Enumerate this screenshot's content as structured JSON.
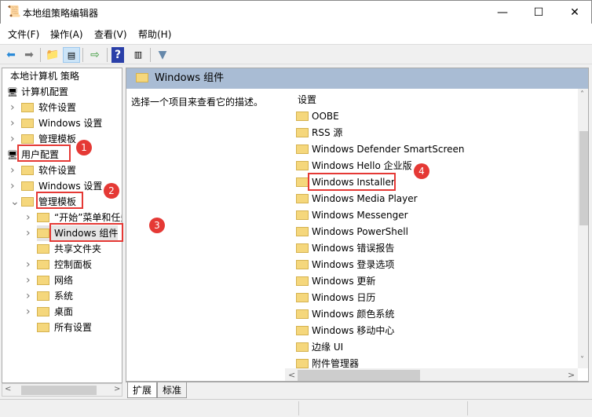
{
  "window": {
    "title": "本地组策略编辑器",
    "minimize": "—",
    "maximize": "☐",
    "close": "✕"
  },
  "menu": [
    "文件(F)",
    "操作(A)",
    "查看(V)",
    "帮助(H)"
  ],
  "tree": [
    {
      "label": "本地计算机 策略",
      "level": 0,
      "chev": ""
    },
    {
      "label": "计算机配置",
      "level": 0,
      "chev": ""
    },
    {
      "label": "软件设置",
      "level": 1,
      "chev": ">"
    },
    {
      "label": "Windows 设置",
      "level": 1,
      "chev": ">"
    },
    {
      "label": "管理模板",
      "level": 1,
      "chev": ">"
    },
    {
      "label": "用户配置",
      "level": 0,
      "chev": ""
    },
    {
      "label": "软件设置",
      "level": 1,
      "chev": ">"
    },
    {
      "label": "Windows 设置",
      "level": 1,
      "chev": ">"
    },
    {
      "label": "管理模板",
      "level": 1,
      "chev": "v"
    },
    {
      "label": "“开始”菜单和任务栏",
      "level": 2,
      "chev": ">"
    },
    {
      "label": "Windows 组件",
      "level": 2,
      "chev": ">"
    },
    {
      "label": "共享文件夹",
      "level": 2,
      "chev": ""
    },
    {
      "label": "控制面板",
      "level": 2,
      "chev": ">"
    },
    {
      "label": "网络",
      "level": 2,
      "chev": ">"
    },
    {
      "label": "系统",
      "level": 2,
      "chev": ">"
    },
    {
      "label": "桌面",
      "level": 2,
      "chev": ">"
    },
    {
      "label": "所有设置",
      "level": 2,
      "chev": ""
    }
  ],
  "right": {
    "header": "Windows 组件",
    "description": "选择一个项目来查看它的描述。",
    "column": "设置",
    "items": [
      "OOBE",
      "RSS 源",
      "Windows Defender SmartScreen",
      "Windows Hello 企业版",
      "Windows Installer",
      "Windows Media Player",
      "Windows Messenger",
      "Windows PowerShell",
      "Windows 错误报告",
      "Windows 登录选项",
      "Windows 更新",
      "Windows 日历",
      "Windows 颜色系统",
      "Windows 移动中心",
      "边缘 UI",
      "附件管理器"
    ]
  },
  "tabs": [
    "扩展",
    "标准"
  ],
  "badges": [
    "1",
    "2",
    "3",
    "4"
  ]
}
